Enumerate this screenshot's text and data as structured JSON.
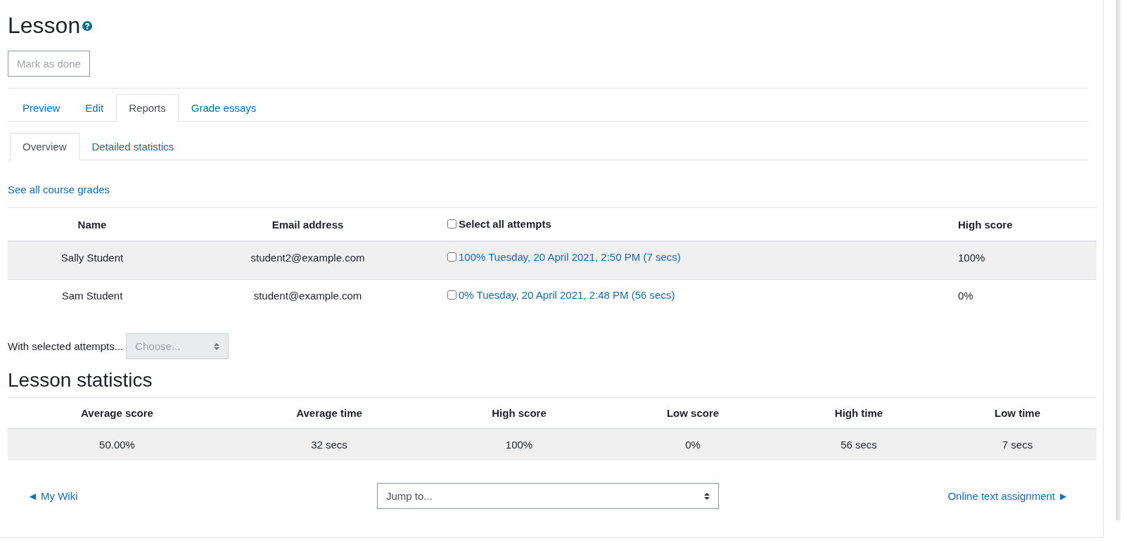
{
  "page_title": "Lesson",
  "mark_done_button": "Mark as done",
  "tabs": [
    {
      "label": "Preview",
      "selected": false
    },
    {
      "label": "Edit",
      "selected": false
    },
    {
      "label": "Reports",
      "selected": true
    },
    {
      "label": "Grade essays",
      "selected": false
    }
  ],
  "subtabs": [
    {
      "label": "Overview",
      "selected": true
    },
    {
      "label": "Detailed statistics",
      "selected": false
    }
  ],
  "course_grades_link": "See all course grades",
  "attempts_table": {
    "columns": [
      "Name",
      "Email address",
      "Select all attempts",
      "High score"
    ],
    "select_all_checked": false,
    "rows": [
      {
        "name": "Sally Student",
        "email": "student2@example.com",
        "attempt": "100% Tuesday, 20 April 2021, 2:50 PM (7 secs)",
        "checked": false,
        "high_score": "100%"
      },
      {
        "name": "Sam Student",
        "email": "student@example.com",
        "attempt": "0% Tuesday, 20 April 2021, 2:48 PM (56 secs)",
        "checked": false,
        "high_score": "0%"
      }
    ]
  },
  "with_selected": {
    "label": "With selected attempts...",
    "placeholder": "Choose..."
  },
  "statistics": {
    "title": "Lesson statistics",
    "columns": [
      "Average score",
      "Average time",
      "High score",
      "Low score",
      "High time",
      "Low time"
    ],
    "rows": [
      [
        "50.00%",
        "32 secs",
        "100%",
        "0%",
        "56 secs",
        "7 secs"
      ]
    ]
  },
  "footer": {
    "prev_link": "◄ My Wiki",
    "jump_placeholder": "Jump to...",
    "next_link": "Online text assignment ►"
  }
}
